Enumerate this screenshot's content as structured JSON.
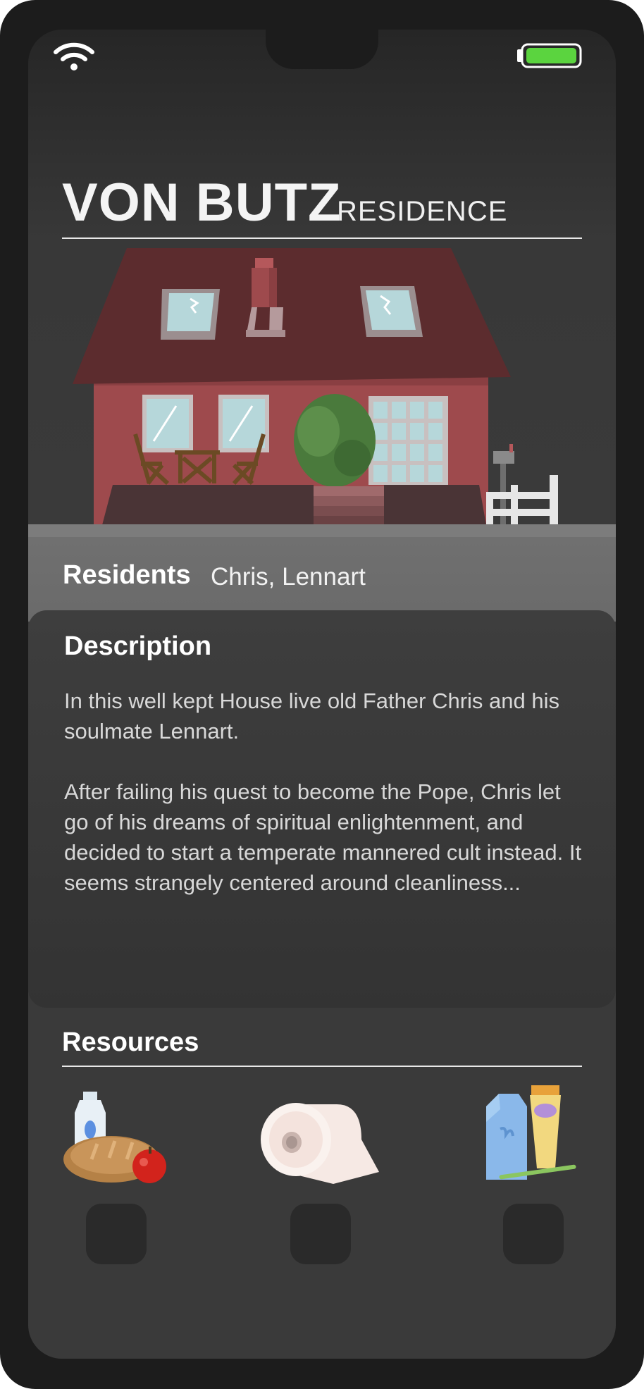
{
  "status_bar": {
    "wifi_icon": "wifi-icon",
    "battery_icon": "battery-full-icon",
    "battery_color": "#5bd43f"
  },
  "header": {
    "name": "VON BUTZ",
    "type": "RESIDENCE"
  },
  "residents": {
    "label": "Residents",
    "names": "Chris, Lennart"
  },
  "description": {
    "title": "Description",
    "paragraphs": [
      "In this well kept House live old Father Chris and his soulmate Lennart.",
      "After failing his quest to become the Pope, Chris let go of his dreams of spiritual enlightenment, and decided to start a temperate mannered cult instead. It seems strangely centered around cleanliness..."
    ]
  },
  "resources": {
    "title": "Resources",
    "items": [
      {
        "icon": "food-icon"
      },
      {
        "icon": "toilet-paper-icon"
      },
      {
        "icon": "hygiene-products-icon"
      }
    ]
  },
  "colors": {
    "background": "#1c1c1c",
    "screen": "#383838",
    "residents_band": "#707070",
    "house_wall": "#9e4a4d",
    "roof": "#5c2c2e"
  }
}
